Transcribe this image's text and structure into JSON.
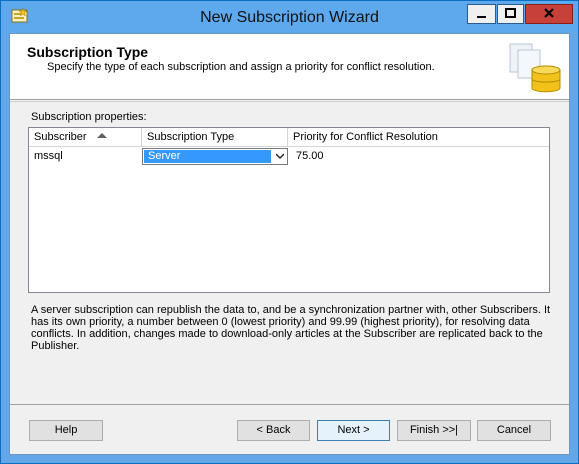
{
  "window": {
    "title": "New Subscription Wizard"
  },
  "header": {
    "title": "Subscription Type",
    "subtitle": "Specify the type of each subscription and assign a priority for conflict resolution."
  },
  "properties": {
    "label": "Subscription properties:",
    "columns": [
      "Subscriber",
      "Subscription Type",
      "Priority for Conflict Resolution"
    ],
    "rows": [
      {
        "subscriber": "mssql",
        "type": "Server",
        "priority": "75.00"
      }
    ]
  },
  "description": "A server subscription can republish the data to, and be a synchronization partner with, other Subscribers. It has its own priority, a number between 0 (lowest priority) and 99.99 (highest priority), for resolving data conflicts. In addition, changes made to download-only articles at the Subscriber are replicated back to the Publisher.",
  "buttons": {
    "help": "Help",
    "back": "< Back",
    "next": "Next >",
    "finish": "Finish >>|",
    "cancel": "Cancel"
  }
}
